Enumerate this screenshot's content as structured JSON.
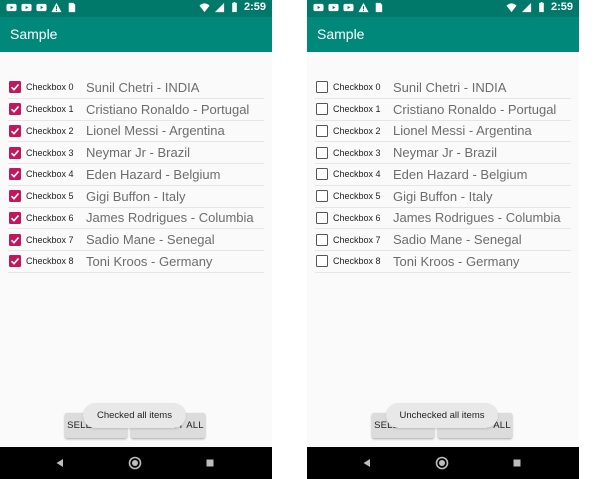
{
  "screens": [
    {
      "id": "left",
      "status_time": "2:59",
      "app_title": "Sample",
      "items": [
        {
          "label": "Checkbox 0",
          "player": "Sunil Chetri - INDIA",
          "checked": true
        },
        {
          "label": "Checkbox 1",
          "player": "Cristiano Ronaldo - Portugal",
          "checked": true
        },
        {
          "label": "Checkbox 2",
          "player": "Lionel Messi - Argentina",
          "checked": true
        },
        {
          "label": "Checkbox 3",
          "player": "Neymar Jr - Brazil",
          "checked": true
        },
        {
          "label": "Checkbox 4",
          "player": "Eden Hazard - Belgium",
          "checked": true
        },
        {
          "label": "Checkbox 5",
          "player": "Gigi Buffon - Italy",
          "checked": true
        },
        {
          "label": "Checkbox 6",
          "player": "James Rodrigues - Columbia",
          "checked": true
        },
        {
          "label": "Checkbox 7",
          "player": "Sadio Mane - Senegal",
          "checked": true
        },
        {
          "label": "Checkbox 8",
          "player": "Toni Kroos - Germany",
          "checked": true
        }
      ],
      "select_all_label": "SELECT ALL",
      "deselect_all_label": "DESELECT ALL",
      "toast": "Checked all items"
    },
    {
      "id": "right",
      "status_time": "2:59",
      "app_title": "Sample",
      "items": [
        {
          "label": "Checkbox 0",
          "player": "Sunil Chetri - INDIA",
          "checked": false
        },
        {
          "label": "Checkbox 1",
          "player": "Cristiano Ronaldo - Portugal",
          "checked": false
        },
        {
          "label": "Checkbox 2",
          "player": "Lionel Messi - Argentina",
          "checked": false
        },
        {
          "label": "Checkbox 3",
          "player": "Neymar Jr - Brazil",
          "checked": false
        },
        {
          "label": "Checkbox 4",
          "player": "Eden Hazard - Belgium",
          "checked": false
        },
        {
          "label": "Checkbox 5",
          "player": "Gigi Buffon - Italy",
          "checked": false
        },
        {
          "label": "Checkbox 6",
          "player": "James Rodrigues - Columbia",
          "checked": false
        },
        {
          "label": "Checkbox 7",
          "player": "Sadio Mane - Senegal",
          "checked": false
        },
        {
          "label": "Checkbox 8",
          "player": "Toni Kroos - Germany",
          "checked": false
        }
      ],
      "select_all_label": "SELECT ALL",
      "deselect_all_label": "DESELECT ALL",
      "toast": "Unchecked all items"
    }
  ],
  "colors": {
    "status_bar": "#00796b",
    "app_bar": "#00897b",
    "checkbox_checked": "#c2185b",
    "navigation_bar": "#000000"
  },
  "icons": [
    "youtube-icon",
    "warning-icon",
    "sim-card-icon",
    "wifi-icon",
    "signal-icon",
    "battery-icon",
    "back-icon",
    "home-icon",
    "recents-icon"
  ]
}
